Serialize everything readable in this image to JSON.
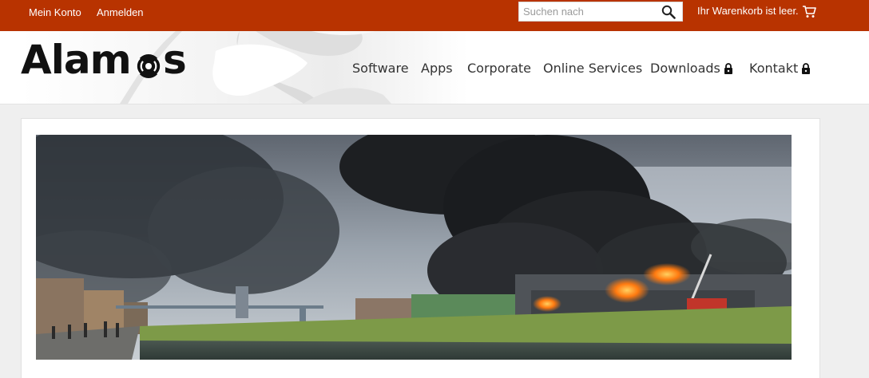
{
  "topbar": {
    "my_account": "Mein Konto",
    "login": "Anmelden",
    "search_placeholder": "Suchen nach",
    "cart_text": "Ihr Warenkorb ist leer.",
    "bg_color": "#b83300"
  },
  "header": {
    "logo_text": "Alam",
    "logo_tail": "s",
    "nav": [
      {
        "label": "Software",
        "locked": false
      },
      {
        "label": "Apps",
        "locked": false
      },
      {
        "label": "Corporate",
        "locked": false
      },
      {
        "label": "Online Services",
        "locked": false
      },
      {
        "label": "Downloads",
        "locked": true
      },
      {
        "label": "Kontakt",
        "locked": true
      }
    ]
  },
  "icons": {
    "search": "search-icon",
    "cart": "cart-icon",
    "lock": "lock-icon",
    "logo_o": "signal-icon"
  }
}
